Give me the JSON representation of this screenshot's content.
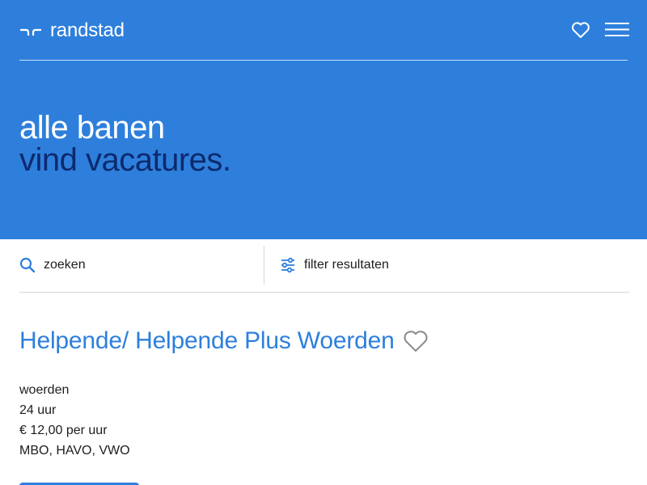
{
  "header": {
    "logo_text": "randstad",
    "icons": {
      "logo": "randstad-logo-icon",
      "favorites": "heart-outline-icon",
      "menu": "hamburger-menu-icon"
    }
  },
  "hero": {
    "line1": "alle banen",
    "line2": "vind vacatures."
  },
  "toolbar": {
    "search_placeholder": "zoeken",
    "search_icon": "search-icon",
    "filter_label": "filter resultaten",
    "filter_icon": "sliders-icon"
  },
  "job": {
    "title": "Helpende/ Helpende Plus Woerden",
    "favorite_icon": "heart-outline-icon",
    "details": [
      "woerden",
      "24 uur",
      "€ 12,00 per uur",
      "MBO, HAVO, VWO"
    ]
  },
  "colors": {
    "brand_blue": "#2e7fdc",
    "dark_navy": "#0c2a6e",
    "text": "#1d1d1b",
    "divider": "#d7d7d7"
  }
}
